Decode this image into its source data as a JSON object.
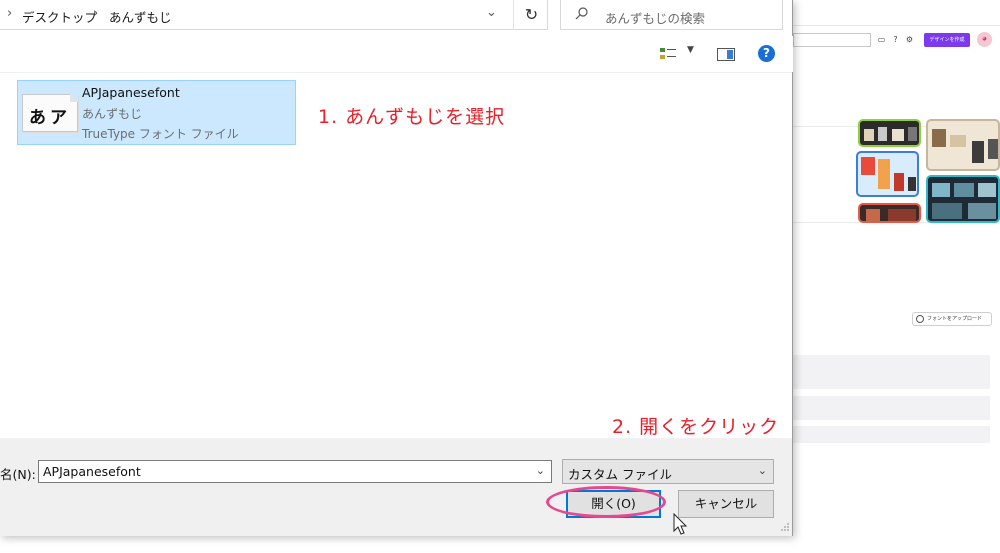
{
  "address_bar": {
    "breadcrumbs": [
      "デスクトップ",
      "あんずもじ"
    ]
  },
  "search": {
    "placeholder": "あんずもじの検索"
  },
  "file_list": {
    "items": [
      {
        "name": "APJapanesefont",
        "subtitle": "あんずもじ",
        "type": "TrueType フォント ファイル",
        "glyph": "あア",
        "selected": true
      }
    ]
  },
  "annotations": {
    "step1": "1. あんずもじを選択",
    "step2": "2. 開くをクリック",
    "color": "#e8202a",
    "ring_color": "#e7478d"
  },
  "footer": {
    "filename_label": "名(N):",
    "filename_value": "APJapanesefont",
    "filetype_value": "カスタム ファイル",
    "open_button": "開く(O)",
    "cancel_button": "キャンセル"
  },
  "background_app": {
    "create_button": "デザインを作成",
    "upload_button": "フォントをアップロード",
    "accent_color": "#7c3aed"
  }
}
